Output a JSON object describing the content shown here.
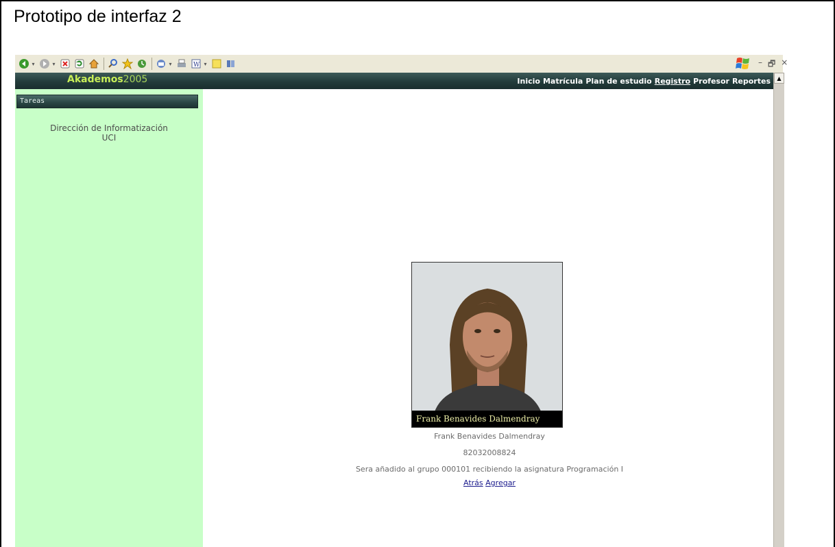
{
  "slide": {
    "title": "Prototipo de interfaz 2"
  },
  "toolbar": {
    "icons": [
      "back-icon",
      "forward-icon",
      "stop-icon",
      "refresh-icon",
      "home-icon",
      "search-icon",
      "favorites-icon",
      "history-icon",
      "mail-icon",
      "print-icon",
      "word-icon",
      "notes-icon",
      "research-icon"
    ],
    "window_controls": [
      "–",
      "🗗",
      "×"
    ]
  },
  "app": {
    "brand_bold": "Akademos",
    "brand_year": "2005",
    "nav": [
      "Inicio",
      "Matrícula",
      "Plan de estudio",
      "Registro",
      "Profesor",
      "Reportes"
    ],
    "active_nav": "Registro"
  },
  "sidebar": {
    "section_title": "Tareas",
    "org_line1": "Dirección de Informatización",
    "org_line2": "UCI"
  },
  "student": {
    "photo_caption": "Frank Benavides Dalmendray",
    "name": "Frank Benavides Dalmendray",
    "id": "82032008824",
    "message": "Sera añadido al grupo 000101 recibiendo la asignatura Programación I"
  },
  "actions": {
    "back_label": "Atrás",
    "add_label": "Agregar"
  },
  "colors": {
    "header": "#233c3b",
    "brand": "#c8ef58",
    "sidebar": "#c8ffc8",
    "link": "#1a1a8c"
  }
}
